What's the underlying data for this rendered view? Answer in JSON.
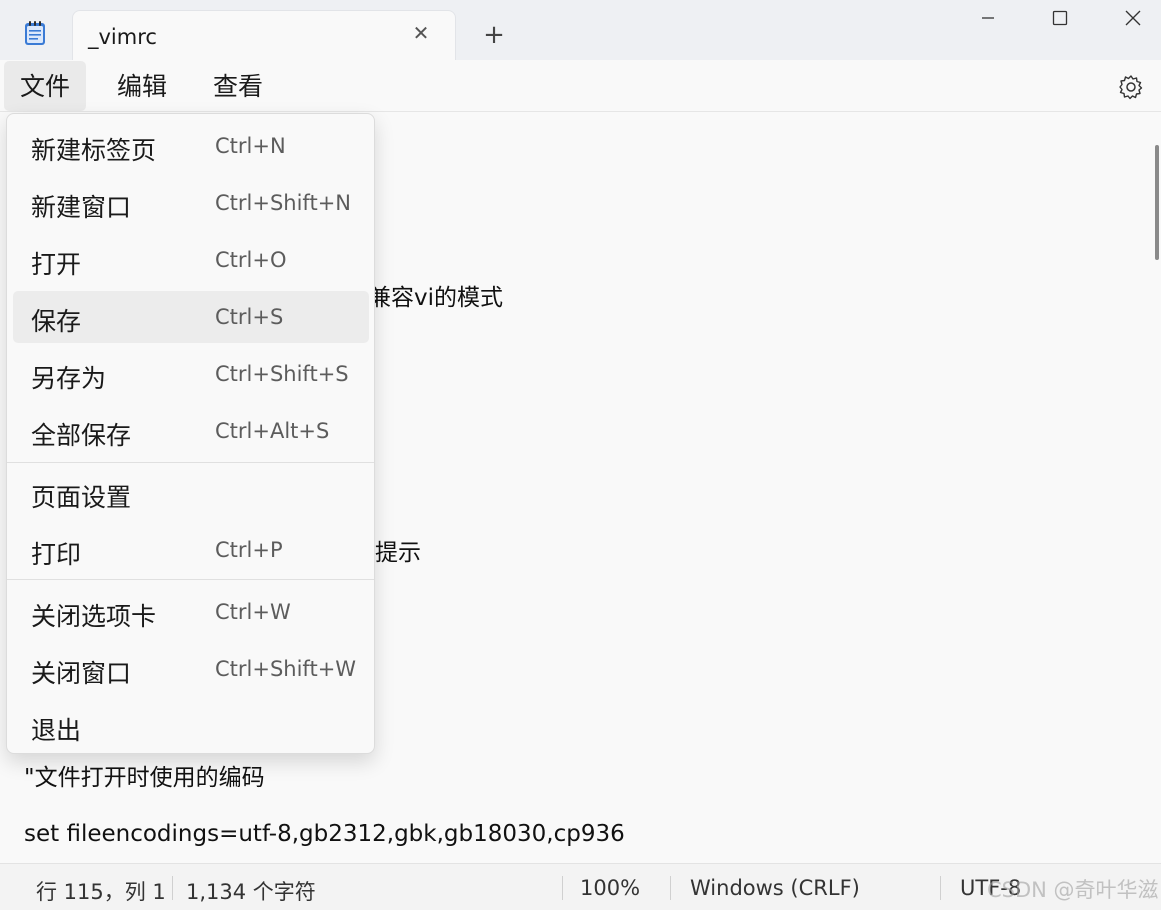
{
  "window": {
    "tab_title": "_vimrc",
    "tab_close_glyph": "✕",
    "new_tab_glyph": "+"
  },
  "menubar": {
    "file": "文件",
    "edit": "编辑",
    "view": "查看"
  },
  "file_menu": {
    "items": [
      {
        "label": "新建标签页",
        "shortcut": "Ctrl+N"
      },
      {
        "label": "新建窗口",
        "shortcut": "Ctrl+Shift+N"
      },
      {
        "label": "打开",
        "shortcut": "Ctrl+O"
      },
      {
        "label": "保存",
        "shortcut": "Ctrl+S"
      },
      {
        "label": "另存为",
        "shortcut": "Ctrl+Shift+S"
      },
      {
        "label": "全部保存",
        "shortcut": "Ctrl+Alt+S"
      },
      {
        "label": "页面设置",
        "shortcut": ""
      },
      {
        "label": "打印",
        "shortcut": "Ctrl+P"
      },
      {
        "label": "关闭选项卡",
        "shortcut": "Ctrl+W"
      },
      {
        "label": "关闭窗口",
        "shortcut": "Ctrl+Shift+W"
      },
      {
        "label": "退出",
        "shortcut": ""
      }
    ]
  },
  "editor": {
    "visible_fragments": [
      "兼容vi的模式",
      "提示"
    ],
    "lines": [
      "\"文件打开时使用的编码",
      "set fileencodings=utf-8,gb2312,gbk,gb18030,cp936"
    ]
  },
  "status": {
    "position": "行 115，列 1",
    "chars": "1,134 个字符",
    "zoom": "100%",
    "line_ending": "Windows (CRLF)",
    "encoding": "UTF-8"
  },
  "watermark": "CSDN @奇叶华滋",
  "colors": {
    "background": "#f9f9f9",
    "titlebar": "#eef0f3",
    "highlight": "#ececec"
  }
}
